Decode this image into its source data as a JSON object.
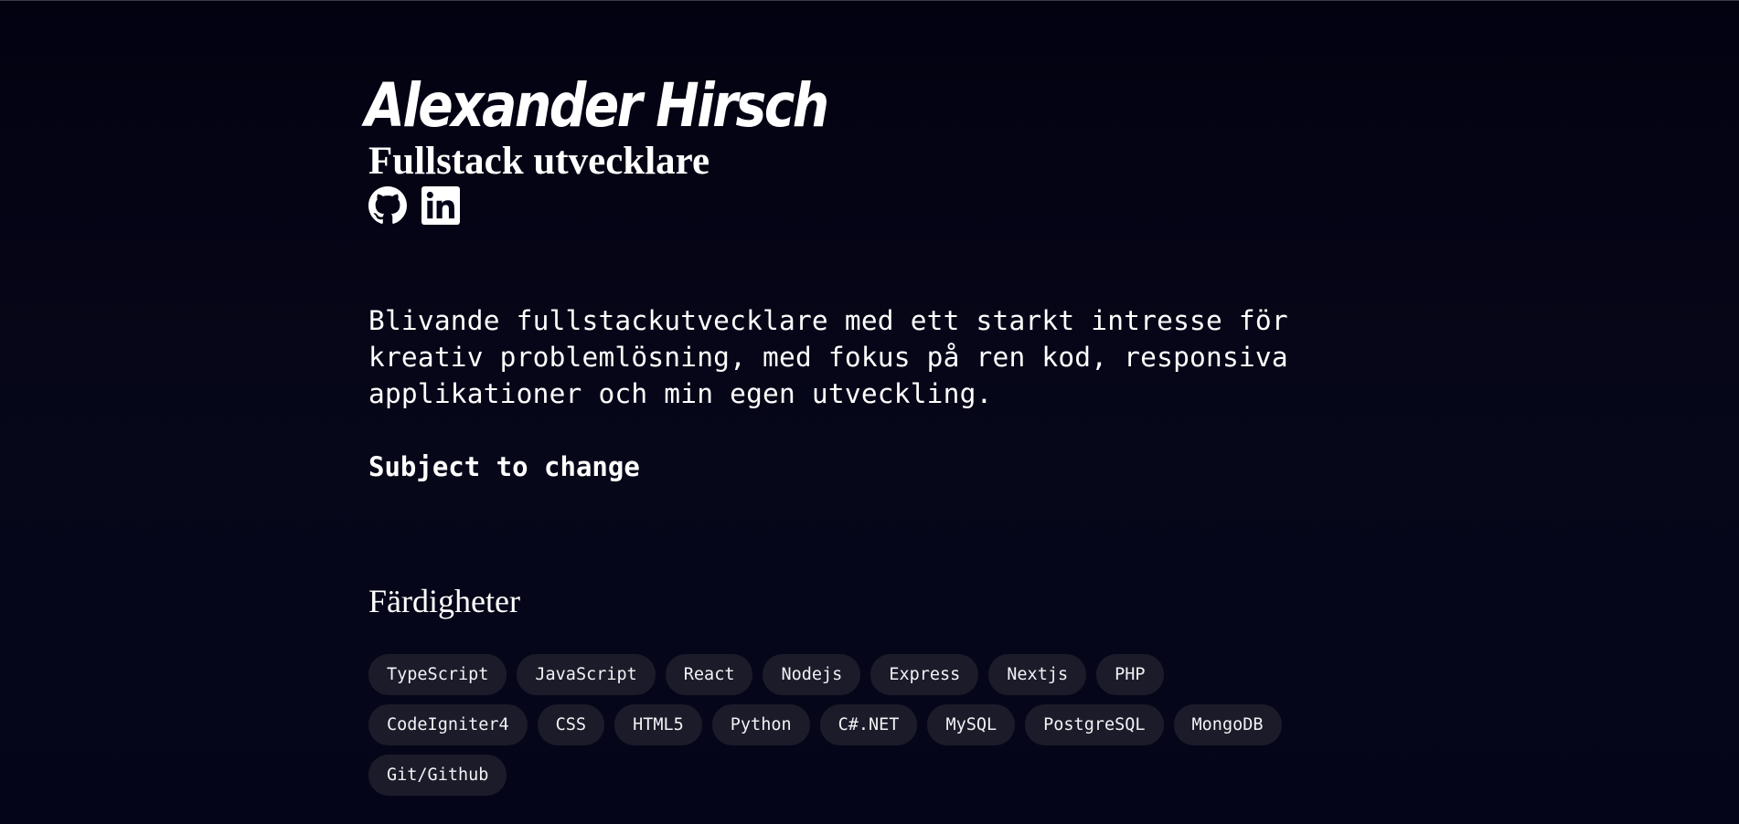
{
  "header": {
    "name": "Alexander Hirsch",
    "role": "Fullstack utvecklare"
  },
  "socials": [
    {
      "label": "GitHub",
      "icon": "github-icon"
    },
    {
      "label": "LinkedIn",
      "icon": "linkedin-icon"
    }
  ],
  "intro": {
    "text": "Blivande fullstackutvecklare med ett starkt intresse för kreativ problemlösning, med fokus på ren kod, responsiva applikationer och min egen utveckling.",
    "note": "Subject to change"
  },
  "skills": {
    "title": "Färdigheter",
    "items": [
      "TypeScript",
      "JavaScript",
      "React",
      "Nodejs",
      "Express",
      "Nextjs",
      "PHP",
      "CodeIgniter4",
      "CSS",
      "HTML5",
      "Python",
      "C#.NET",
      "MySQL",
      "PostgreSQL",
      "MongoDB",
      "Git/Github"
    ]
  },
  "colors": {
    "background": "#05051a",
    "text": "#ffffff",
    "chip_background": "#1b1b29"
  }
}
